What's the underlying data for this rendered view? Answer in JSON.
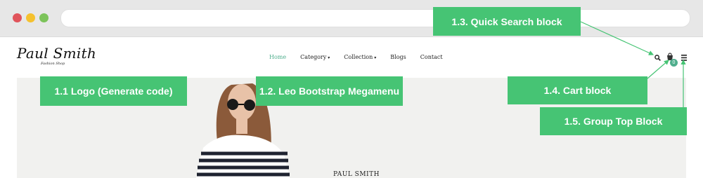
{
  "window": {
    "controls": {
      "close_color": "#e0545b",
      "minimize_color": "#f5c12e",
      "maximize_color": "#7cc35a"
    }
  },
  "store": {
    "logo": {
      "name": "Paul Smith",
      "tagline": "Fashion Shop"
    },
    "nav": [
      {
        "label": "Home",
        "active": true,
        "has_dropdown": false
      },
      {
        "label": "Category",
        "active": false,
        "has_dropdown": true
      },
      {
        "label": "Collection",
        "active": false,
        "has_dropdown": true
      },
      {
        "label": "Blogs",
        "active": false,
        "has_dropdown": false
      },
      {
        "label": "Contact",
        "active": false,
        "has_dropdown": false
      }
    ],
    "icons": {
      "search": "search-icon",
      "cart": "cart-icon",
      "menu": "menu-icon"
    },
    "cart_count": "0",
    "accent_color": "#4fae8d",
    "hero_caption": "PAUL SMITH"
  },
  "callouts": {
    "logo": "1.1 Logo (Generate code)",
    "megamenu": "1.2. Leo Bootstrap Megamenu",
    "quick_search": "1.3. Quick Search block",
    "cart": "1.4. Cart block",
    "group_top": "1.5. Group Top Block",
    "color": "#46c474"
  }
}
